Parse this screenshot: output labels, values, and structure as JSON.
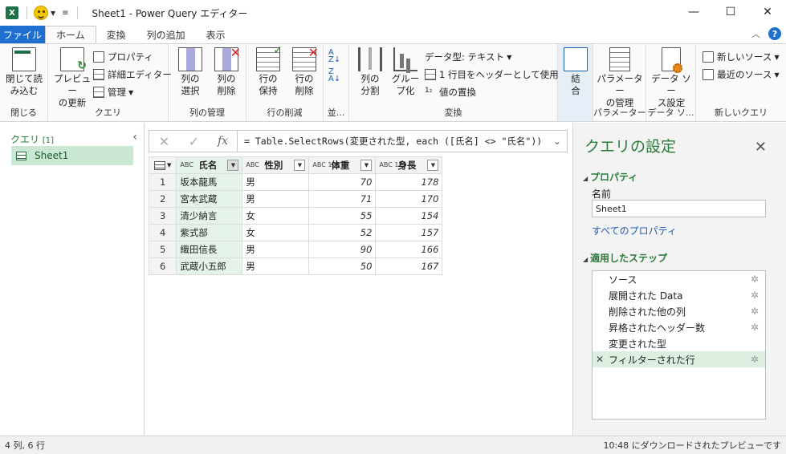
{
  "window": {
    "title": "Sheet1 - Power Query エディター",
    "app_icon": "excel-icon",
    "accent": "#1e6fd0"
  },
  "tabs": [
    {
      "label": "ファイル"
    },
    {
      "label": "ホーム"
    },
    {
      "label": "変換"
    },
    {
      "label": "列の追加"
    },
    {
      "label": "表示"
    }
  ],
  "ribbon": {
    "close": {
      "btn": "閉じて読\nみ込む",
      "label": "閉じる"
    },
    "query": {
      "preview": "プレビュー\nの更新",
      "properties": "プロパティ",
      "advanced_editor": "詳細エディター",
      "manage": "管理",
      "label": "クエリ"
    },
    "columns": {
      "select": "列の\n選択",
      "remove": "列の\n削除",
      "label": "列の管理"
    },
    "rows": {
      "keep": "行の\n保持",
      "remove": "行の\n削除",
      "label": "行の削減"
    },
    "sort": {
      "label": "並..."
    },
    "transform": {
      "split": "列の\n分割",
      "group": "グルー\nプ化",
      "datatype": "データ型: テキスト",
      "first_row_header": "1 行目をヘッダーとして使用",
      "replace": "値の置換",
      "label": "変換"
    },
    "combine": {
      "btn": "結\n合",
      "label": ""
    },
    "params": {
      "btn": "パラメーター\nの管理",
      "label": "パラメーター"
    },
    "datasource": {
      "btn": "データ ソー\nス設定",
      "label": "データ ソ..."
    },
    "newquery": {
      "new_source": "新しいソース",
      "recent": "最近のソース",
      "label": "新しいクエリ"
    }
  },
  "queries": {
    "header": "クエリ",
    "count": "[1]",
    "items": [
      {
        "name": "Sheet1"
      }
    ]
  },
  "formula": {
    "text": "= Table.SelectRows(変更された型, each ([氏名] <> \"氏名\"))"
  },
  "grid": {
    "columns": [
      {
        "type": "ABC",
        "name": "氏名"
      },
      {
        "type": "ABC",
        "name": "性別"
      },
      {
        "type": "ABC 123",
        "name": "体重"
      },
      {
        "type": "ABC 123",
        "name": "身長"
      }
    ],
    "rows": [
      {
        "n": "1",
        "name": "坂本龍馬",
        "gender": "男",
        "weight": "70",
        "height": "178"
      },
      {
        "n": "2",
        "name": "宮本武蔵",
        "gender": "男",
        "weight": "71",
        "height": "170"
      },
      {
        "n": "3",
        "name": "清少納言",
        "gender": "女",
        "weight": "55",
        "height": "154"
      },
      {
        "n": "4",
        "name": "紫式部",
        "gender": "女",
        "weight": "52",
        "height": "157"
      },
      {
        "n": "5",
        "name": "織田信長",
        "gender": "男",
        "weight": "90",
        "height": "166"
      },
      {
        "n": "6",
        "name": "武蔵小五郎",
        "gender": "男",
        "weight": "50",
        "height": "167"
      }
    ]
  },
  "settings": {
    "title": "クエリの設定",
    "properties_header": "プロパティ",
    "name_label": "名前",
    "name_value": "Sheet1",
    "all_properties": "すべてのプロパティ",
    "steps_header": "適用したステップ",
    "steps": [
      {
        "label": "ソース"
      },
      {
        "label": "展開された Data"
      },
      {
        "label": "削除された他の列"
      },
      {
        "label": "昇格されたヘッダー数"
      },
      {
        "label": "変更された型"
      },
      {
        "label": "フィルターされた行"
      }
    ]
  },
  "status": {
    "left": "4 列, 6 行",
    "right": "10:48 にダウンロードされたプレビューです"
  }
}
